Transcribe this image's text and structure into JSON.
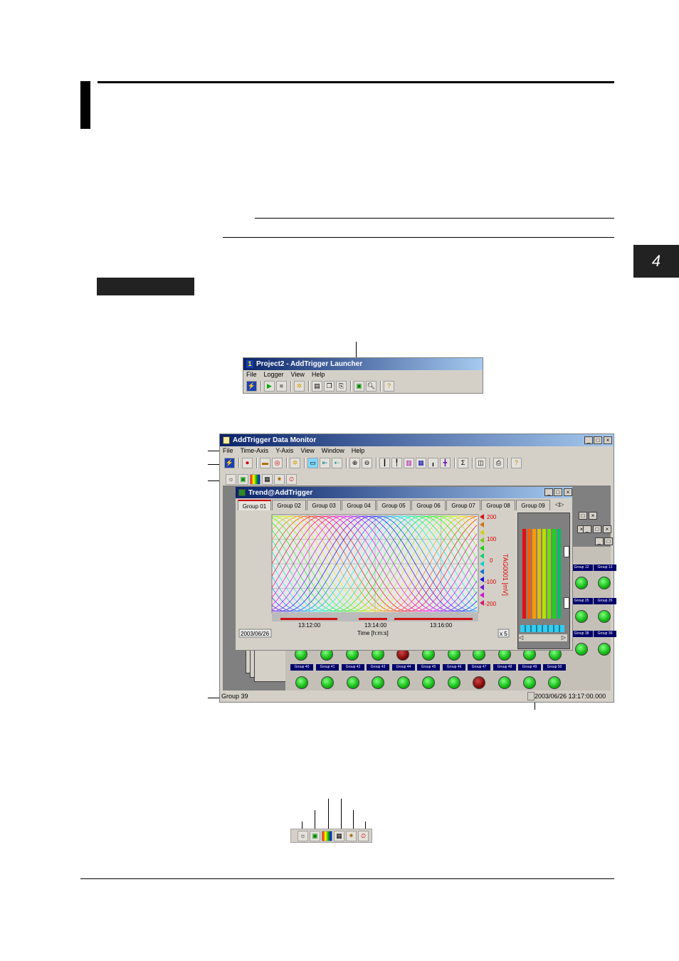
{
  "page": {
    "chapter_number": "4"
  },
  "launcher": {
    "title": "Project2 - AddTrigger Launcher",
    "menu": [
      "File",
      "Logger",
      "View",
      "Help"
    ]
  },
  "monitor": {
    "title": "AddTrigger Data Monitor",
    "menu": [
      "File",
      "Time-Axis",
      "Y-Axis",
      "View",
      "Window",
      "Help"
    ],
    "status_left": "Group 39",
    "status_right": "2003/06/26 13:17:00.000"
  },
  "trend": {
    "title": "Trend@AddTrigger",
    "tabs": [
      "Group 01",
      "Group 02",
      "Group 03",
      "Group 04",
      "Group 05",
      "Group 06",
      "Group 07",
      "Group 08",
      "Group 09"
    ],
    "date": "2003/06/26",
    "zoom": "x 5",
    "channel_label": "TAG0001 [mV]",
    "y_ticks": [
      "200",
      "100",
      "0",
      "-100",
      "-200"
    ],
    "x_ticks": [
      "13:12:00",
      "13:14:00",
      "13:16:00"
    ],
    "x_label": "Time [h:m:s]"
  },
  "groups_right": [
    "Group 12",
    "Group 13",
    "Group 25",
    "Group 26",
    "Group 38",
    "Group 39"
  ],
  "groups_bottom": [
    "Group 40",
    "Group 41",
    "Group 42",
    "Group 43",
    "Group 44",
    "Group 45",
    "Group 46",
    "Group 47",
    "Group 48",
    "Group 49",
    "Group 50"
  ],
  "colors": {
    "title_start": "#0a246a",
    "title_end": "#a6caf0",
    "window_bg": "#d4d0c8",
    "lamp_green": "#12b812",
    "trend_red": "#e01010"
  }
}
